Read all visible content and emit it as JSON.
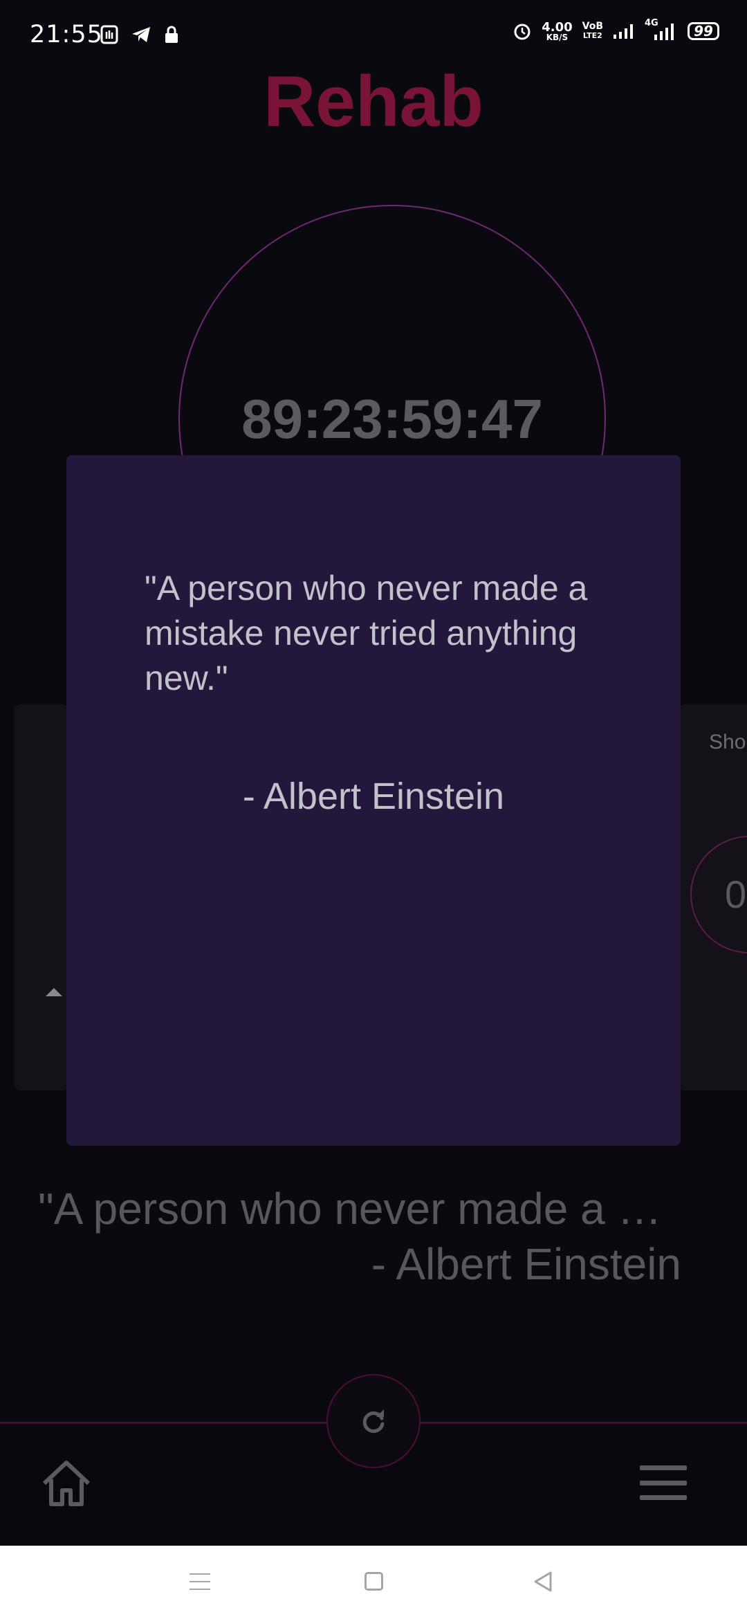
{
  "status_bar": {
    "time": "21:55",
    "speed_value": "4.00",
    "speed_unit": "KB/S",
    "volte_top": "VoB",
    "volte_bottom": "LTE2",
    "network_label": "4G",
    "battery": "99"
  },
  "app": {
    "title": "Rehab",
    "timer": "89:23:59:47"
  },
  "background_card": {
    "right_label": "Sho",
    "right_value": "0"
  },
  "dialog": {
    "quote": "\"A person who never made a mistake never tried anything new.\"",
    "author": "-  Albert Einstein"
  },
  "background_quote": {
    "quote": "\"A person who never made a …",
    "author": "- Albert Einstein"
  },
  "colors": {
    "title": "#7a1437",
    "dialog_bg": "#23173b",
    "accent_line": "#4b0e35",
    "timer_ring": "#6d2a72"
  },
  "icons": {
    "refresh": "refresh-icon",
    "home": "home-icon",
    "menu": "menu-icon"
  }
}
